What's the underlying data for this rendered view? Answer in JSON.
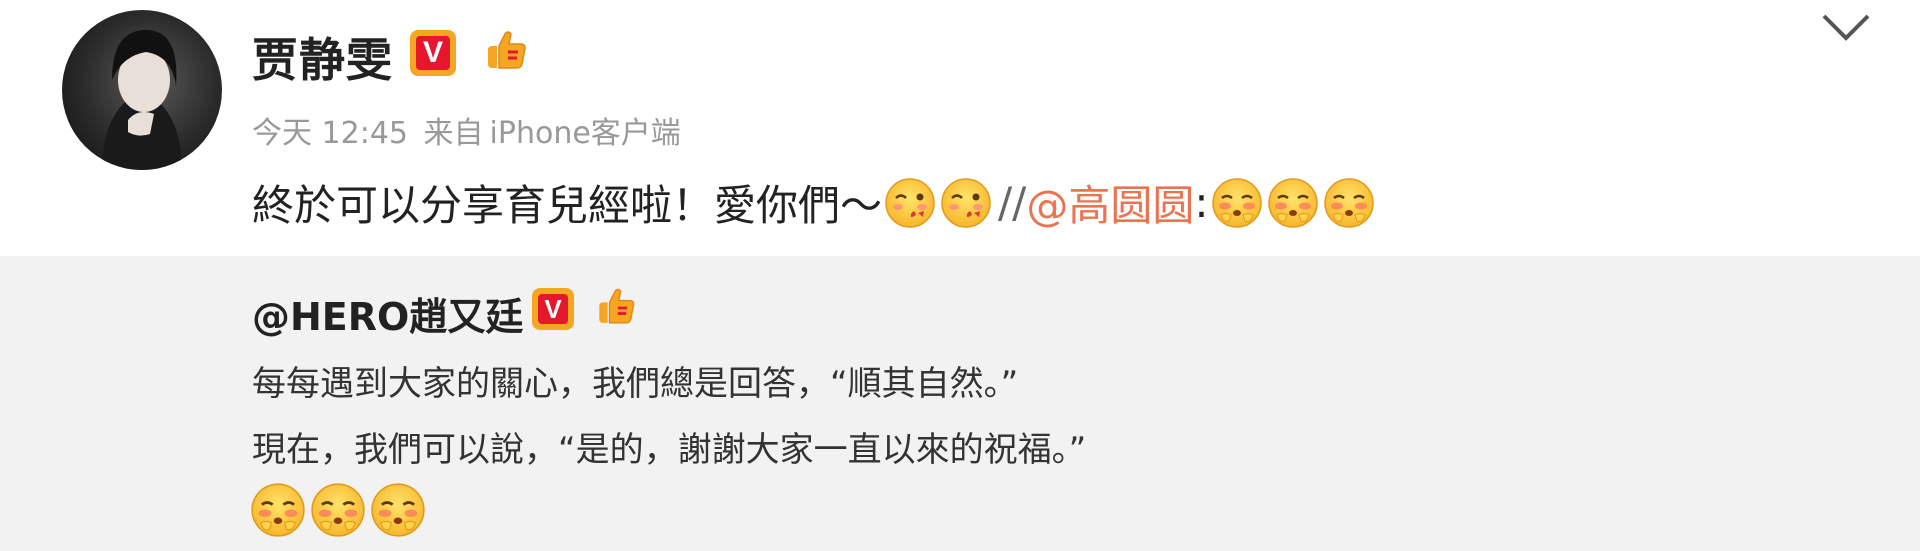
{
  "post": {
    "author": "贾静雯",
    "verified_badge": "V",
    "time": "今天 12:45",
    "source_prefix": "来自",
    "source": "iPhone客户端",
    "text_main": "終於可以分享育兒經啦！愛你們～",
    "separator": "//",
    "mention": "@高圆圆",
    "mention_colon": ":"
  },
  "retweet": {
    "author": "@HERO趙又廷",
    "verified_badge": "V",
    "line1": "每每遇到大家的關心，我們總是回答，“順其自然。”",
    "line2": "現在，我們可以說，“是的，謝謝大家一直以來的祝福。”"
  },
  "icons": {
    "menu": "chevron-down-icon",
    "verified": "verified-v-icon",
    "member": "thumbs-up-member-icon",
    "wink_emoji": "kiss-wink-emoji",
    "blush_emoji": "shy-blush-emoji"
  },
  "colors": {
    "mention": "#eb7350",
    "verified_bg": "#e6162d",
    "verified_ring": "#f5a623",
    "retweet_bg": "#f2f2f2",
    "meta_text": "#999999"
  }
}
